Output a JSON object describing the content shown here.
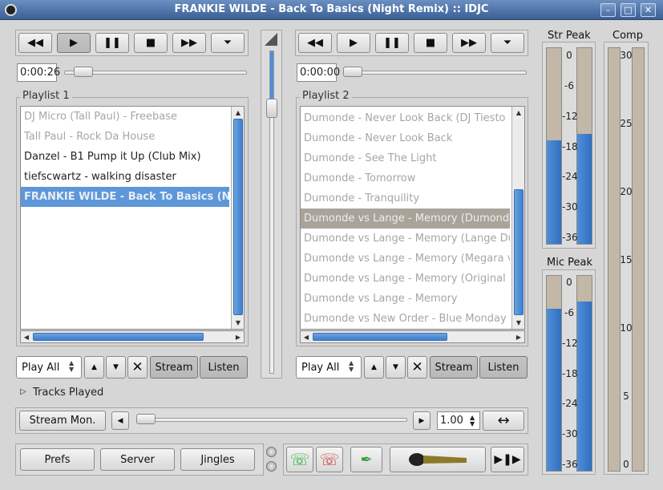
{
  "window": {
    "title": "FRANKIE WILDE - Back To Basics (Night Remix) :: IDJC"
  },
  "player1": {
    "time": "0:00:26",
    "playlist_label": "Playlist 1",
    "tracks": [
      {
        "title": "DJ Micro (Tall Paul) - Freebase",
        "state": "played"
      },
      {
        "title": "Tall Paul - Rock Da House",
        "state": "played"
      },
      {
        "title": "Danzel - B1 Pump it Up (Club Mix)",
        "state": "normal"
      },
      {
        "title": "tiefscwartz - walking disaster",
        "state": "normal"
      },
      {
        "title": "FRANKIE WILDE - Back To Basics (Night Remix)",
        "state": "selected"
      }
    ],
    "mode": "Play All",
    "stream_label": "Stream",
    "listen_label": "Listen"
  },
  "player2": {
    "time": "0:00:00",
    "playlist_label": "Playlist 2",
    "tracks": [
      {
        "title": "Dumonde - Never Look Back (DJ Tiesto Remix)",
        "state": "played"
      },
      {
        "title": "Dumonde - Never Look Back",
        "state": "played"
      },
      {
        "title": "Dumonde - See The Light",
        "state": "played"
      },
      {
        "title": "Dumonde - Tomorrow",
        "state": "played"
      },
      {
        "title": "Dumonde - Tranquility",
        "state": "played"
      },
      {
        "title": "Dumonde vs Lange - Memory (Dumonde Remix)",
        "state": "cued"
      },
      {
        "title": "Dumonde vs Lange - Memory (Lange Dub Mix)",
        "state": "played"
      },
      {
        "title": "Dumonde vs Lange - Memory (Megara vs DJ Lee Remix)",
        "state": "played"
      },
      {
        "title": "Dumonde vs Lange - Memory (Original Mix)",
        "state": "played"
      },
      {
        "title": "Dumonde vs Lange - Memory",
        "state": "played"
      },
      {
        "title": "Dumonde vs New Order - Blue Monday (Extended)",
        "state": "played"
      }
    ],
    "mode": "Play All",
    "stream_label": "Stream",
    "listen_label": "Listen"
  },
  "tracks_played_label": "Tracks Played",
  "stream_mon_label": "Stream Mon.",
  "speed_value": "1.00",
  "bottom_buttons": {
    "prefs": "Prefs",
    "server": "Server",
    "jingles": "Jingles"
  },
  "meters": {
    "str_peak_label": "Str Peak",
    "mic_peak_label": "Mic Peak",
    "comp_label": "Comp",
    "str_scale": [
      "0",
      "-6",
      "-12",
      "-18",
      "-24",
      "-30",
      "-36"
    ],
    "mic_scale": [
      "0",
      "-6",
      "-12",
      "-18",
      "-24",
      "-30",
      "-36"
    ],
    "comp_scale": [
      "30",
      "25",
      "20",
      "15",
      "10",
      "5",
      "0"
    ],
    "str_left_level": 0.53,
    "str_right_level": 0.56,
    "mic_left_level": 0.83,
    "mic_right_level": 0.87,
    "comp_level": 0.0
  },
  "colors": {
    "accent": "#5e97d8",
    "phone_green": "#2fae3a",
    "phone_red": "#d33a3a"
  }
}
